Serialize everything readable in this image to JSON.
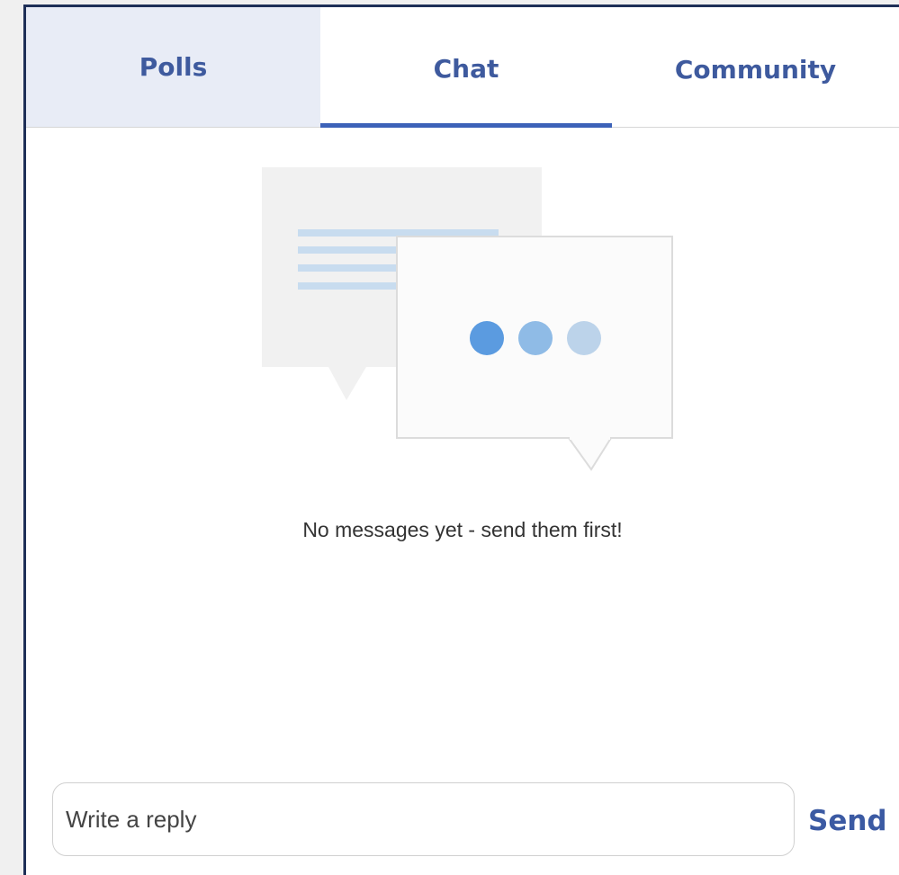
{
  "tabs": {
    "polls_label": "Polls",
    "chat_label": "Chat",
    "community_label": "Community",
    "active": "Chat"
  },
  "chat": {
    "empty_message": "No messages yet - send them first!",
    "illustration_icon": "chat-bubbles-icon"
  },
  "composer": {
    "placeholder": "Write a reply",
    "value": "",
    "send_label": "Send"
  },
  "colors": {
    "accent": "#3c62b8",
    "tab_text": "#3e5a9e",
    "inactive_tab_bg": "#e8ecf6",
    "dot_1": "#5b9be0",
    "dot_2": "#8fbbe6",
    "dot_3": "#bcd3ea"
  }
}
